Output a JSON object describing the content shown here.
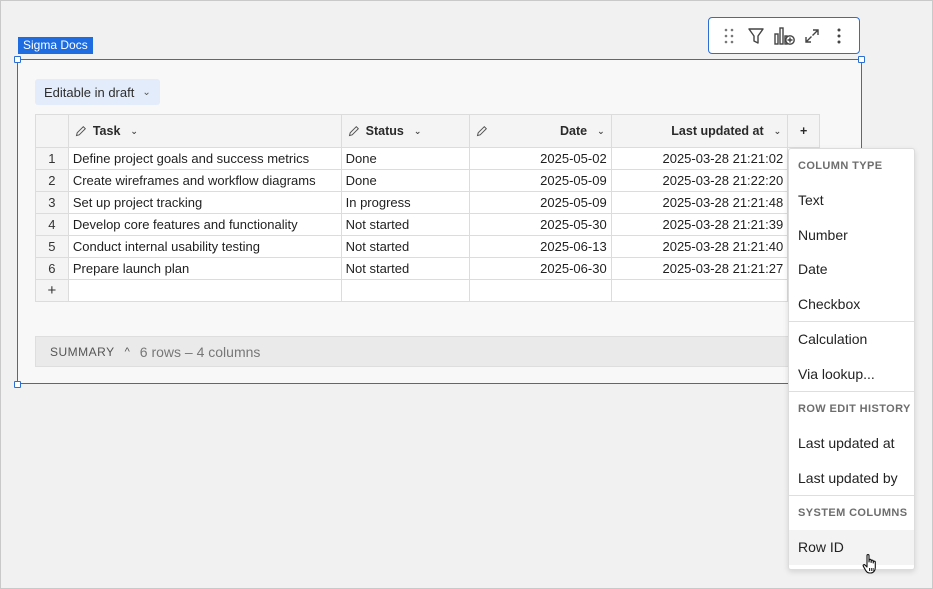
{
  "element_label": "Sigma Docs",
  "badge": {
    "label": "Editable in draft"
  },
  "toolbar": {
    "icons": [
      "drag-handle-icon",
      "filter-icon",
      "add-chart-icon",
      "expand-icon",
      "more-vertical-icon"
    ]
  },
  "table": {
    "columns": [
      {
        "label": "Task",
        "editable": true
      },
      {
        "label": "Status",
        "editable": true
      },
      {
        "label": "Date",
        "editable": true
      },
      {
        "label": "Last updated at",
        "editable": false
      }
    ],
    "add_column_symbol": "+",
    "add_row_symbol": "+",
    "rows": [
      {
        "num": "1",
        "task": "Define project goals and success metrics",
        "status": "Done",
        "date": "2025-05-02",
        "updated": "2025-03-28 21:21:02"
      },
      {
        "num": "2",
        "task": "Create wireframes and workflow diagrams",
        "status": "Done",
        "date": "2025-05-09",
        "updated": "2025-03-28 21:22:20"
      },
      {
        "num": "3",
        "task": "Set up project tracking",
        "status": "In progress",
        "date": "2025-05-09",
        "updated": "2025-03-28 21:21:48"
      },
      {
        "num": "4",
        "task": "Develop core features and functionality",
        "status": "Not started",
        "date": "2025-05-30",
        "updated": "2025-03-28 21:21:39"
      },
      {
        "num": "5",
        "task": "Conduct internal usability testing",
        "status": "Not started",
        "date": "2025-06-13",
        "updated": "2025-03-28 21:21:40"
      },
      {
        "num": "6",
        "task": "Prepare launch plan",
        "status": "Not started",
        "date": "2025-06-30",
        "updated": "2025-03-28 21:21:27"
      }
    ]
  },
  "summary": {
    "label": "SUMMARY",
    "count": "6 rows – 4 columns"
  },
  "menu": {
    "column_type_header": "COLUMN TYPE",
    "column_types": [
      "Text",
      "Number",
      "Date",
      "Checkbox"
    ],
    "derived": [
      "Calculation",
      "Via lookup..."
    ],
    "row_edit_header": "ROW EDIT HISTORY",
    "row_edit": [
      "Last updated at",
      "Last updated by"
    ],
    "system_header": "SYSTEM COLUMNS",
    "system": [
      "Row ID"
    ]
  }
}
